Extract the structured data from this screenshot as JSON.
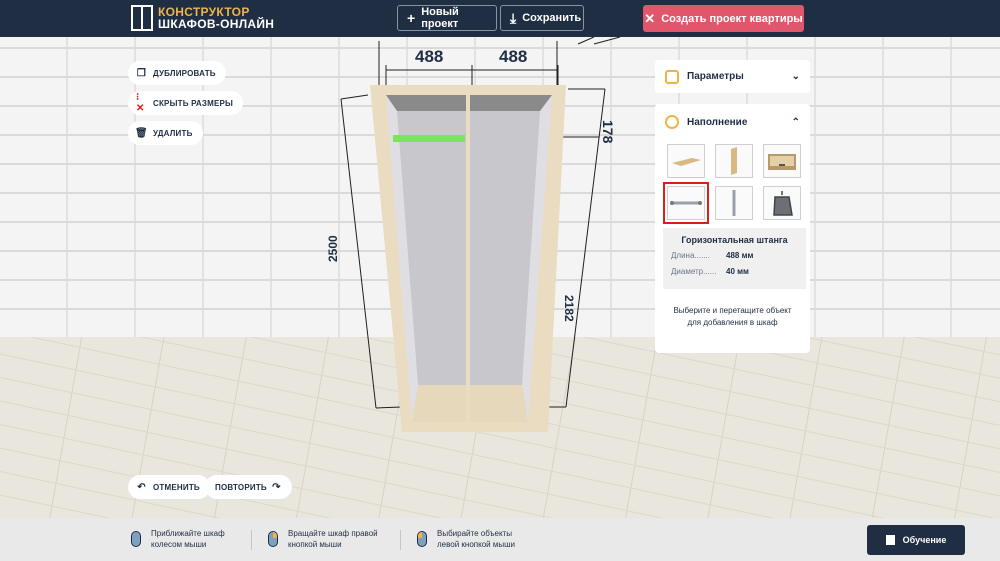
{
  "header": {
    "logo_line1": "КОНСТРУКТОР",
    "logo_line2": "ШКАФОВ-ОНЛАЙН",
    "new_project": "Новый проект",
    "save": "Сохранить",
    "create_apartment": "Создать проект квартиры"
  },
  "toolbar": {
    "duplicate": "ДУБЛИРОВАТЬ",
    "hide_dimensions": "СКРЫТЬ РАЗМЕРЫ",
    "delete": "УДАЛИТЬ",
    "undo": "ОТМЕНИТЬ",
    "redo": "ПОВТОРИТЬ"
  },
  "dimensions": {
    "left_section": "488",
    "right_section": "488",
    "total_height": "2500",
    "inner_height": "2182",
    "top_offset": "178"
  },
  "panel": {
    "parameters": "Параметры",
    "filling": "Наполнение",
    "items": [
      {
        "name": "shelf-item",
        "selected": false
      },
      {
        "name": "vertical-divider-item",
        "selected": false
      },
      {
        "name": "drawer-item",
        "selected": false
      },
      {
        "name": "horizontal-rod-item",
        "selected": true
      },
      {
        "name": "vertical-rod-item",
        "selected": false
      },
      {
        "name": "hanger-item",
        "selected": false
      }
    ],
    "selected_title": "Горизонтальная штанга",
    "length_label": "Длина.......",
    "length_value": "488 мм",
    "diameter_label": "Диаметр......",
    "diameter_value": "40 мм",
    "hint": "Выберите и перетащите объект для добавления в шкаф"
  },
  "footer": {
    "tip1_line1": "Приближайте шкаф",
    "tip1_line2": "колесом мыши",
    "tip2_line1": "Вращайте шкаф правой",
    "tip2_line2": "кнопкой мыши",
    "tip3_line1": "Выбирайте объекты",
    "tip3_line2": "левой кнопкой мыши",
    "learn": "Обучение"
  },
  "colors": {
    "topbar": "#1f2e43",
    "accent": "#f0b34a",
    "cta": "#e0576c",
    "selection": "#e01919",
    "rod_highlight": "#7fe35a"
  }
}
